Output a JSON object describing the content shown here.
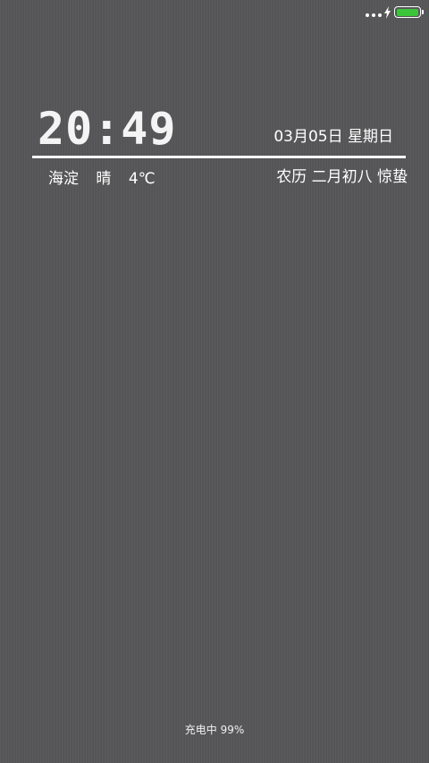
{
  "status_bar": {
    "icons": [
      "more-dots-icon",
      "charging-bolt-icon",
      "battery-icon"
    ],
    "battery_level_percent": 99,
    "battery_color": "#3cc43a"
  },
  "lockscreen": {
    "time": "20:49",
    "date": "03月05日  星期日",
    "location": "海淀",
    "weather": "晴",
    "temperature": "4℃",
    "lunar": "农历   二月初八 惊蛰",
    "charging_status": "充电中 99%"
  },
  "colors": {
    "background": "#555557",
    "text": "#ffffff"
  }
}
